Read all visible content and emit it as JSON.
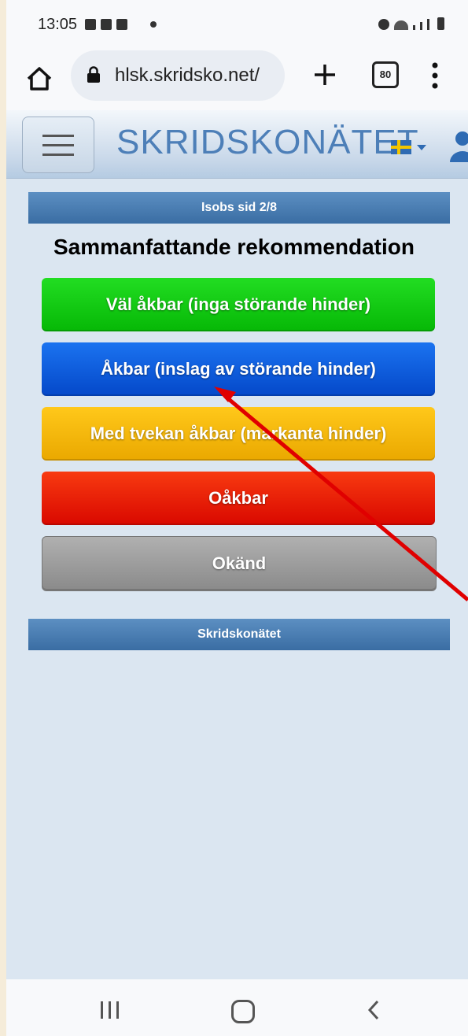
{
  "status_bar": {
    "time": "13:05"
  },
  "browser": {
    "url": "hlsk.skridsko.net/",
    "tab_count": "80"
  },
  "site": {
    "logo": "SKRIDSKONÄTET"
  },
  "page": {
    "top_bar": "Isobs sid 2/8",
    "heading": "Sammanfattande rekommendation",
    "options": [
      {
        "label": "Väl åkbar (inga störande hinder)",
        "color": "#10c810"
      },
      {
        "label": "Åkbar (inslag av störande hinder)",
        "color": "#0a5de0"
      },
      {
        "label": "Med tvekan åkbar (markanta hinder)",
        "color": "#f4b400"
      },
      {
        "label": "Oåkbar",
        "color": "#e21a00"
      },
      {
        "label": "Okänd",
        "color": "#9a9a9a"
      }
    ],
    "bottom_bar": "Skridskonätet"
  }
}
